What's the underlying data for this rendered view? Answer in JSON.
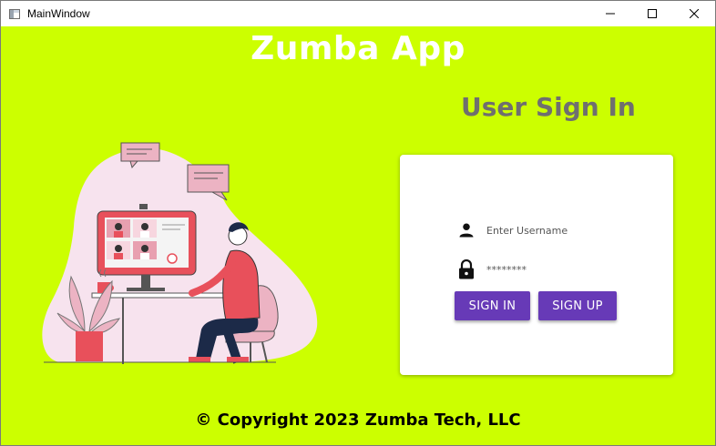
{
  "window": {
    "title": "MainWindow",
    "controls": {
      "minimize_icon": "minimize-icon",
      "maximize_icon": "maximize-icon",
      "close_icon": "close-icon"
    }
  },
  "header": {
    "app_title": "Zumba App",
    "page_title": "User Sign In"
  },
  "form": {
    "username": {
      "placeholder": "Enter Username",
      "value": "",
      "icon": "user-icon"
    },
    "password": {
      "placeholder": "********",
      "value": "",
      "icon": "lock-icon"
    },
    "signin_label": "SIGN IN",
    "signup_label": "SIGN UP"
  },
  "footer": {
    "copyright": "© Copyright 2023 Zumba Tech, LLC"
  },
  "colors": {
    "background": "#ccff00",
    "primary": "#673ab7",
    "page_title": "#6f6f6f"
  }
}
